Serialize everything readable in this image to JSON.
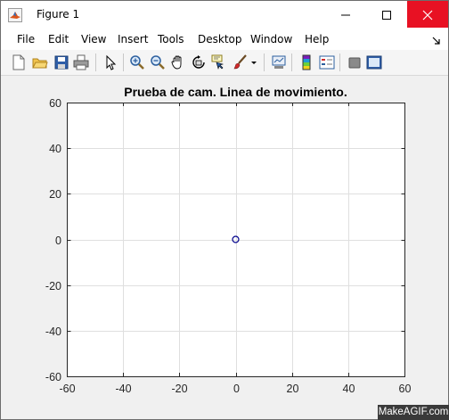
{
  "window": {
    "title": "Figure 1",
    "menu": [
      "File",
      "Edit",
      "View",
      "Insert",
      "Tools",
      "Desktop",
      "Window",
      "Help"
    ]
  },
  "toolbar": {
    "buttons": [
      "new-figure-icon",
      "open-file-icon",
      "save-icon",
      "print-icon",
      "edit-plot-icon",
      "zoom-in-icon",
      "zoom-out-icon",
      "pan-icon",
      "rotate-3d-icon",
      "data-cursor-icon",
      "brush-icon",
      "link-plot-icon",
      "insert-colorbar-icon",
      "insert-legend-icon",
      "hide-plot-tools-icon",
      "show-plot-tools-icon"
    ]
  },
  "chart_data": {
    "type": "scatter",
    "title": "Prueba de cam. Linea de movimiento.",
    "xlabel": "",
    "ylabel": "",
    "xlim": [
      -60,
      60
    ],
    "ylim": [
      -60,
      60
    ],
    "xticks": [
      -60,
      -40,
      -20,
      0,
      20,
      40,
      60
    ],
    "yticks": [
      -60,
      -40,
      -20,
      0,
      20,
      40,
      60
    ],
    "grid": true,
    "marker": "o",
    "marker_color": "#00008b",
    "points": [
      {
        "x": 0,
        "y": 0
      }
    ]
  },
  "watermark": "MakeAGIF.com"
}
